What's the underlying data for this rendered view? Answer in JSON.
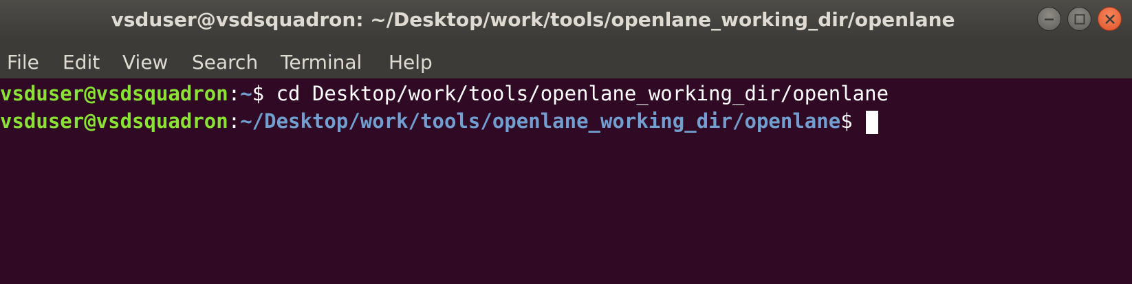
{
  "window": {
    "title": "vsduser@vsdsquadron: ~/Desktop/work/tools/openlane_working_dir/openlane",
    "buttons": {
      "minimize_icon": "minimize-icon",
      "maximize_icon": "maximize-icon",
      "close_icon": "close-icon"
    }
  },
  "menubar": {
    "items": [
      {
        "label": "File"
      },
      {
        "label": "Edit"
      },
      {
        "label": "View"
      },
      {
        "label": "Search"
      },
      {
        "label": "Terminal"
      },
      {
        "label": "Help"
      }
    ]
  },
  "terminal": {
    "lines": [
      {
        "user": "vsduser@vsdsquadron",
        "sep": ":",
        "path": "~",
        "prompt": "$ ",
        "command": "cd Desktop/work/tools/openlane_working_dir/openlane"
      },
      {
        "user": "vsduser@vsdsquadron",
        "sep": ":",
        "path": "~/Desktop/work/tools/openlane_working_dir/openlane",
        "prompt": "$ ",
        "command": ""
      }
    ]
  },
  "colors": {
    "background": "#300a24",
    "titlebar": "#3c3b37",
    "user": "#8ae234",
    "path": "#729fcf",
    "text": "#ffffff",
    "close_button": "#e0542a"
  }
}
